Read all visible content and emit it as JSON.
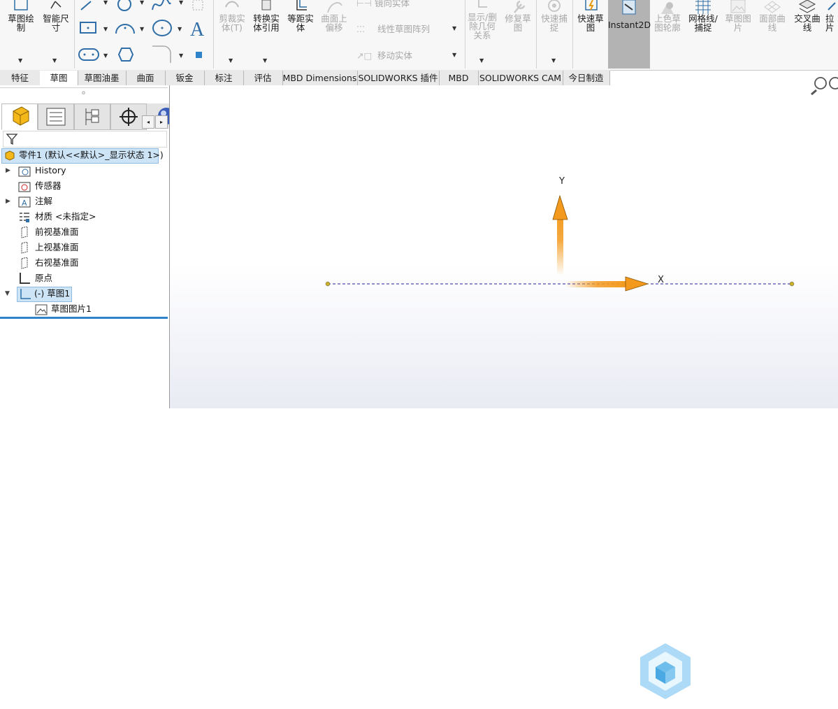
{
  "ribbon": {
    "groups": {
      "sketch_draw": "草图绘\n制",
      "smart_dim": "智能尺\n寸",
      "trim": "剪裁实\n体(T)",
      "convert": "转换实\n体引用",
      "offset": "等距实\n体",
      "surface_offset": "曲面上\n偏移",
      "mirror": "镜向实体",
      "linear_pattern": "线性草图阵列",
      "move": "移动实体",
      "show_relations": "显示/删\n除几何\n关系",
      "repair": "修复草\n图",
      "quick_snap": "快速捕\n捉",
      "rapid_sketch": "快速草\n图",
      "instant2d": "Instant2D",
      "shaded_contour": "上色草\n图轮廓",
      "grid_snap": "网格线/\n捕捉",
      "sketch_picture": "草图图\n片",
      "face_curve": "面部曲\n线",
      "intersect_curve": "交叉曲\n线",
      "pull": "拉\n片"
    }
  },
  "tabs": [
    "特征",
    "草图",
    "草图油墨",
    "曲面",
    "钣金",
    "标注",
    "评估",
    "MBD Dimensions",
    "SOLIDWORKS 插件",
    "MBD",
    "SOLIDWORKS CAM",
    "今日制造"
  ],
  "active_tab": "草图",
  "feature_tree": {
    "root": "零件1  (默认<<默认>_显示状态 1>)",
    "items": {
      "history": "History",
      "sensors": "传感器",
      "annotations": "注解",
      "material": "材质 <未指定>",
      "front_plane": "前视基准面",
      "top_plane": "上视基准面",
      "right_plane": "右视基准面",
      "origin": "原点",
      "sketch1": "(-) 草图1",
      "sketch_picture1": "草图图片1"
    }
  },
  "graphics": {
    "x_axis_label": "X",
    "y_axis_label": "Y"
  },
  "colors": {
    "accent_blue": "#2f83c8",
    "axis_orange": "#f39a1e",
    "selection_bg": "#cde4f7",
    "dashed_line": "#2020a0"
  }
}
